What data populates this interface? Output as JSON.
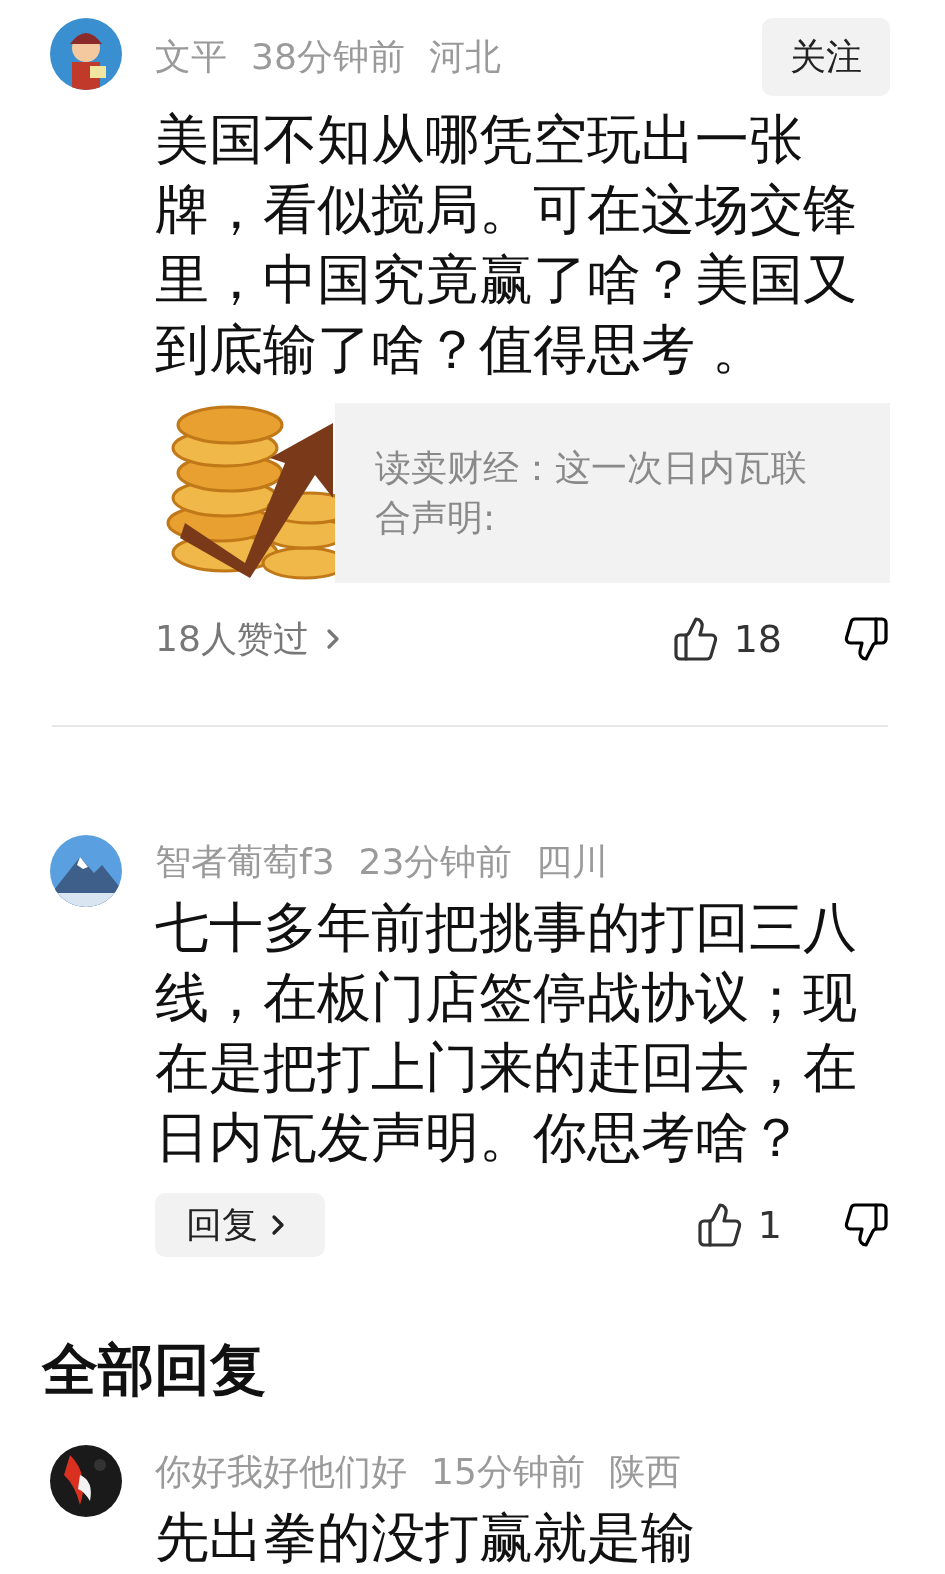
{
  "comments": [
    {
      "name": "文平",
      "time": "38分钟前",
      "location": "河北",
      "follow": "关注",
      "body": "美国不知从哪凭空玩出一张牌，看似搅局。可在这场交锋里，中国究竟赢了啥？美国又到底输了啥？值得思考 。",
      "link_card": {
        "kind": "picture",
        "text": "读卖财经：这一次日内瓦联合声明:"
      },
      "likers": "18人赞过",
      "likes": "18"
    },
    {
      "name": "智者葡萄f3",
      "time": "23分钟前",
      "location": "四川",
      "body": "七十多年前把挑事的打回三八线，在板门店签停战协议；现在是把打上门来的赶回去，在日内瓦发声明。你思考啥？",
      "reply": "回复",
      "likes": "1"
    }
  ],
  "section_title": "全部回复",
  "replies": [
    {
      "name": "你好我好他们好",
      "time": "15分钟前",
      "location": "陕西",
      "body": "先出拳的没打赢就是输"
    }
  ]
}
